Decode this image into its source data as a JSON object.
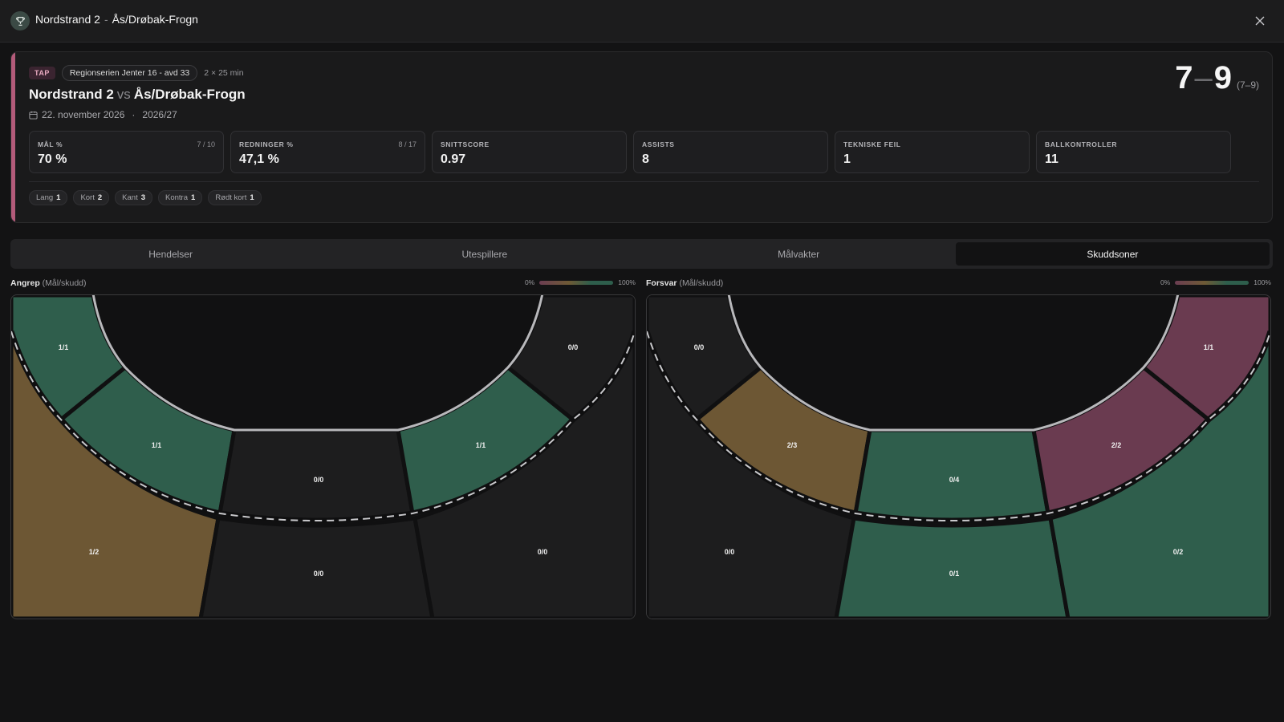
{
  "header": {
    "home_team": "Nordstrand 2",
    "separator": "-",
    "away_team": "Ås/Drøbak-Frogn",
    "icon": "trophy-icon",
    "close_icon": "close-icon"
  },
  "match": {
    "result_badge": "TAP",
    "league": "Regionserien Jenter 16 - avd 33",
    "duration": "2 × 25 min",
    "home_team": "Nordstrand 2",
    "vs": "vs",
    "away_team": "Ås/Drøbak-Frogn",
    "date": "22. november 2026",
    "date_separator": "·",
    "season": "2026/27",
    "score_home": "7",
    "score_away": "9",
    "score_half": "(7–9)",
    "accent_color": "#b35b7a"
  },
  "stats": [
    {
      "label": "MÅL %",
      "sub": "7 / 10",
      "value": "70 %"
    },
    {
      "label": "REDNINGER %",
      "sub": "8 / 17",
      "value": "47,1 %"
    },
    {
      "label": "SNITTSCORE",
      "sub": "",
      "value": "0.97"
    },
    {
      "label": "ASSISTS",
      "sub": "",
      "value": "8"
    },
    {
      "label": "TEKNISKE FEIL",
      "sub": "",
      "value": "1"
    },
    {
      "label": "BALLKONTROLLER",
      "sub": "",
      "value": "11"
    }
  ],
  "shot_types": [
    {
      "label": "Lang",
      "count": "1"
    },
    {
      "label": "Kort",
      "count": "2"
    },
    {
      "label": "Kant",
      "count": "3"
    },
    {
      "label": "Kontra",
      "count": "1"
    },
    {
      "label": "Rødt kort",
      "count": "1"
    }
  ],
  "tabs": [
    {
      "label": "Hendelser",
      "active": false
    },
    {
      "label": "Utespillere",
      "active": false
    },
    {
      "label": "Målvakter",
      "active": false
    },
    {
      "label": "Skuddsoner",
      "active": true
    }
  ],
  "legend": {
    "min": "0%",
    "max": "100%"
  },
  "colors": {
    "green": "#2f5e4c",
    "amber": "#6d5734",
    "rose": "#6a3b50",
    "empty": "#1d1d1e"
  },
  "attack": {
    "title": "Angrep",
    "subtitle": "(Mål/skudd)",
    "zones": {
      "left_wing": "1/1",
      "left_back": "1/1",
      "center_six": "0/0",
      "right_back": "1/1",
      "right_wing": "0/0",
      "left_long": "1/2",
      "center_long": "0/0",
      "right_long": "0/0"
    }
  },
  "defense": {
    "title": "Forsvar",
    "subtitle": "(Mål/skudd)",
    "zones": {
      "left_wing": "0/0",
      "left_back": "2/3",
      "center_six": "0/4",
      "right_back": "2/2",
      "right_wing": "1/1",
      "left_long": "0/0",
      "center_long": "0/1",
      "right_long": "0/2"
    }
  }
}
